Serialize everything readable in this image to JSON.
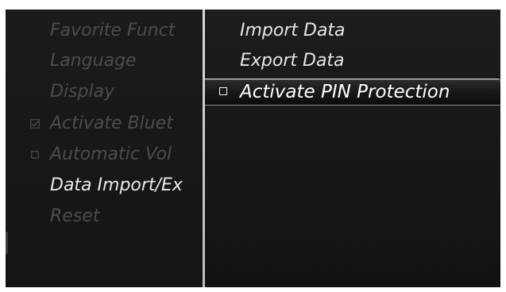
{
  "left_menu": {
    "items": [
      {
        "label": "Favorite Funct",
        "state": "dim",
        "check": null
      },
      {
        "label": "Language",
        "state": "dim",
        "check": null
      },
      {
        "label": "Display",
        "state": "dim",
        "check": null
      },
      {
        "label": "Activate Bluet",
        "state": "dim",
        "check": "checked"
      },
      {
        "label": "Automatic Vol",
        "state": "dim",
        "check": "unchecked"
      },
      {
        "label": "Data Import/Ex",
        "state": "active",
        "check": null
      },
      {
        "label": "Reset",
        "state": "dim",
        "check": null
      }
    ]
  },
  "right_menu": {
    "items": [
      {
        "label": "Import Data"
      },
      {
        "label": "Export Data"
      },
      {
        "label": "Activate PIN Protection",
        "selected": true,
        "check": "unchecked"
      }
    ]
  },
  "colors": {
    "background": "#161618",
    "divider": "#d0d0d0",
    "text_active": "#e8e8ea",
    "text_dim": "#4c4c50",
    "highlight_border": "#d4d4d6"
  }
}
